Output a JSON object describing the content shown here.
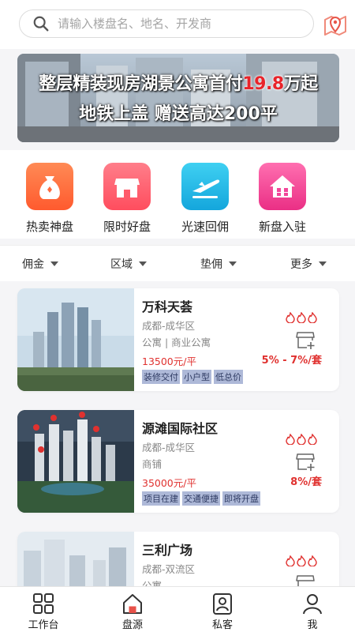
{
  "search": {
    "placeholder": "请输入楼盘名、地名、开发商"
  },
  "banner": {
    "line1_prefix": "整层精装现房湖景公寓首付",
    "line1_highlight": "19.8",
    "line1_suffix": "万起",
    "line2": "地铁上盖  赠送高达200平"
  },
  "quick_actions": [
    {
      "label": "热卖神盘",
      "icon": "money-bag-icon",
      "color": "#ff6a3d"
    },
    {
      "label": "限时好盘",
      "icon": "shop-icon",
      "color": "#ff5a6a"
    },
    {
      "label": "光速回佣",
      "icon": "airplane-icon",
      "color": "#1fb8e6"
    },
    {
      "label": "新盘入驻",
      "icon": "house-icon",
      "color": "#f2469a"
    }
  ],
  "filters": [
    "佣金",
    "区域",
    "垫佣",
    "更多"
  ],
  "listings": [
    {
      "name": "万科天荟",
      "location": "成都-成华区",
      "type": "公寓 | 商业公寓",
      "price": "13500元/平",
      "tags": [
        "装修交付",
        "小户型",
        "低总价"
      ],
      "commission": "5% - 7%/套"
    },
    {
      "name": "源滩国际社区",
      "location": "成都-成华区",
      "type": "商铺",
      "price": "35000元/平",
      "tags": [
        "项目在建",
        "交通便捷",
        "即将开盘"
      ],
      "commission": "8%/套"
    },
    {
      "name": "三利广场",
      "location": "成都-双流区",
      "type": "公寓",
      "price": "",
      "tags": [],
      "commission": ""
    }
  ],
  "tabs": [
    {
      "label": "工作台",
      "icon": "grid-icon"
    },
    {
      "label": "盘源",
      "icon": "home-icon"
    },
    {
      "label": "私客",
      "icon": "contact-icon"
    },
    {
      "label": "我",
      "icon": "user-icon"
    }
  ],
  "colors": {
    "accent_red": "#e0312f",
    "tag_bg": "#aeb9d8"
  }
}
